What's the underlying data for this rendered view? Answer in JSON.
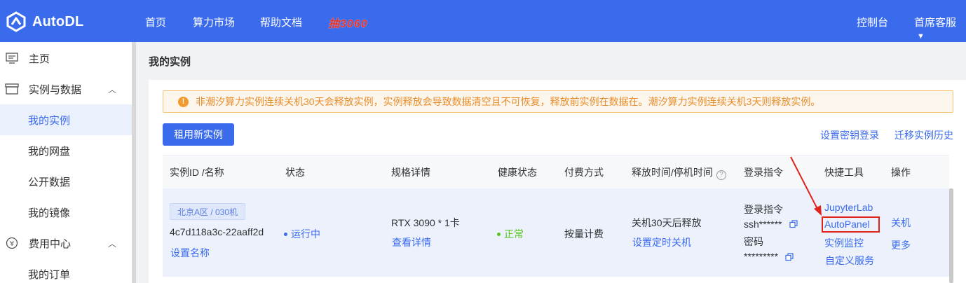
{
  "header": {
    "brand": "AutoDL",
    "nav": [
      "首页",
      "算力市场",
      "帮助文档"
    ],
    "promo": "抽3060",
    "console": "控制台",
    "support": "首席客服"
  },
  "sidebar": {
    "items": [
      {
        "label": "主页",
        "icon": "home-icon"
      },
      {
        "label": "实例与数据",
        "icon": "box-icon"
      },
      {
        "label": "我的实例"
      },
      {
        "label": "我的网盘"
      },
      {
        "label": "公开数据"
      },
      {
        "label": "我的镜像"
      },
      {
        "label": "费用中心",
        "icon": "yen-icon"
      },
      {
        "label": "我的订单"
      }
    ]
  },
  "page": {
    "title": "我的实例",
    "alert": "非潮汐算力实例连续关机30天会释放实例，实例释放会导致数据清空且不可恢复，释放前实例在数据在。潮汐算力实例连续关机3天则释放实例。",
    "new_instance": "租用新实例",
    "set_key_login": "设置密钥登录",
    "migrate_history": "迁移实例历史"
  },
  "table": {
    "headers": [
      "实例ID /名称",
      "状态",
      "规格详情",
      "健康状态",
      "付费方式",
      "释放时间/停机时间",
      "登录指令",
      "快捷工具",
      "操作"
    ],
    "help_mark": "?",
    "row": {
      "region_tag": "北京A区 / 030机",
      "instance_id": "4c7d118a3c-22aaff2d",
      "set_name": "设置名称",
      "status": "运行中",
      "status_color": "#3a6bed",
      "spec": "RTX 3090 * 1卡",
      "view_details": "查看详情",
      "health": "正常",
      "health_color": "#52c41a",
      "billing": "按量计费",
      "release": "关机30天后释放",
      "set_shutdown": "设置定时关机",
      "login_label": "登录指令",
      "ssh": "ssh******",
      "password_label": "密码",
      "password": "*********",
      "tools": [
        "JupyterLab",
        "AutoPanel",
        "实例监控",
        "自定义服务"
      ],
      "actions": [
        "关机",
        "更多"
      ]
    }
  },
  "colors": {
    "brand": "#3a6bed",
    "annotation": "#e1241b"
  }
}
